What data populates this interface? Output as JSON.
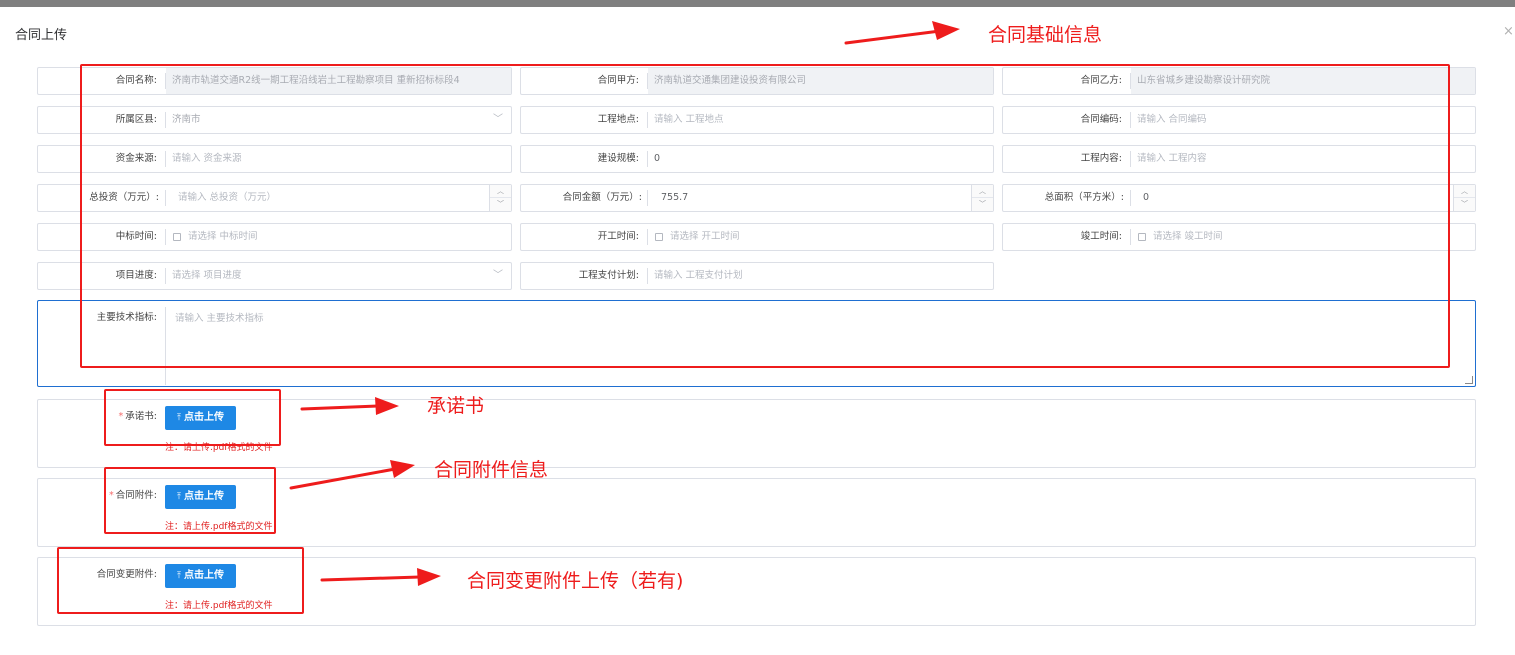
{
  "dialog": {
    "title": "合同上传",
    "close_glyph": "×"
  },
  "form": {
    "contract_name": {
      "label": "合同名称:",
      "value": "济南市轨道交通R2线一期工程沿线岩土工程勘察项目 重新招标标段4"
    },
    "party_a": {
      "label": "合同甲方:",
      "value": "济南轨道交通集团建设投资有限公司"
    },
    "party_b": {
      "label": "合同乙方:",
      "value": "山东省城乡建设勘察设计研究院"
    },
    "district": {
      "label": "所属区县:",
      "value": "济南市"
    },
    "project_location": {
      "label": "工程地点:",
      "placeholder": "请输入 工程地点"
    },
    "contract_code": {
      "label": "合同编码:",
      "placeholder": "请输入 合同编码"
    },
    "fund_source": {
      "label": "资金来源:",
      "placeholder": "请输入 资金来源"
    },
    "construction_scale": {
      "label": "建设规模:",
      "value": "0"
    },
    "project_content": {
      "label": "工程内容:",
      "placeholder": "请输入 工程内容"
    },
    "total_investment": {
      "label": "总投资（万元）:",
      "placeholder": "请输入 总投资（万元）"
    },
    "contract_amount": {
      "label": "合同金额（万元）:",
      "value": "755.7"
    },
    "total_area": {
      "label": "总面积（平方米）:",
      "value": "0"
    },
    "bid_time": {
      "label": "中标时间:",
      "placeholder": "请选择 中标时间"
    },
    "start_time": {
      "label": "开工时间:",
      "placeholder": "请选择 开工时间"
    },
    "completion_time": {
      "label": "竣工时间:",
      "placeholder": "请选择 竣工时间"
    },
    "project_progress": {
      "label": "项目进度:",
      "placeholder": "请选择 项目进度"
    },
    "payment_plan": {
      "label": "工程支付计划:",
      "placeholder": "请输入 工程支付计划"
    },
    "tech_indicators": {
      "label": "主要技术指标:",
      "placeholder": "请输入 主要技术指标"
    }
  },
  "uploads": [
    {
      "label": "承诺书:",
      "required": "*",
      "button": "点击上传",
      "note": "注：请上传.pdf格式的文件"
    },
    {
      "label": "合同附件:",
      "required": "*",
      "button": "点击上传",
      "note": "注：请上传.pdf格式的文件"
    },
    {
      "label": "合同变更附件:",
      "required": "",
      "button": "点击上传",
      "note": "注：请上传.pdf格式的文件"
    }
  ],
  "annotations": {
    "basic_info": "合同基础信息",
    "commitment": "承诺书",
    "attachment": "合同附件信息",
    "change_attachment": "合同变更附件上传（若有)"
  },
  "colors": {
    "annotation_red": "#ee1c1c",
    "primary_button": "#1e88e5",
    "focus_border": "#1f6fd1"
  },
  "icons": {
    "upload": "upload-icon",
    "close": "close-icon",
    "dropdown": "chevron-down-icon",
    "calendar": "calendar-icon",
    "spinner": "stepper-icon"
  }
}
